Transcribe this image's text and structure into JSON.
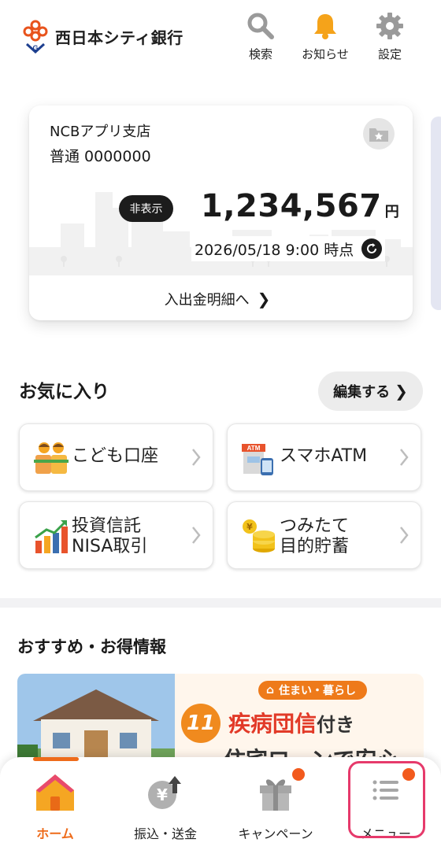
{
  "header": {
    "bank_name": "西日本シティ銀行",
    "search_label": "検索",
    "notify_label": "お知らせ",
    "settings_label": "設定"
  },
  "account_card": {
    "branch": "NCBアプリ支店",
    "account": "普通 0000000",
    "hide_label": "非表示",
    "balance": "1,234,567",
    "currency": "円",
    "as_of": "2026/05/18 9:00 時点",
    "detail_link": "入出金明細へ"
  },
  "favorites": {
    "title": "お気に入り",
    "edit_label": "編集する",
    "items": [
      {
        "line1": "こども口座",
        "line2": ""
      },
      {
        "line1": "スマホATM",
        "line2": ""
      },
      {
        "line1": "投資信託",
        "line2": "NISA取引"
      },
      {
        "line1": "つみたて",
        "line2": "目的貯蓄"
      }
    ]
  },
  "recommend": {
    "title": "おすすめ・お得情報",
    "banner": {
      "tag": "住まい・暮らし",
      "number": "11",
      "line1_highlight": "疾病団信",
      "line1_rest": "付き",
      "line2": "住宅ローンで安心"
    }
  },
  "bottom_nav": {
    "items": [
      {
        "label": "ホーム",
        "active": true
      },
      {
        "label": "振込・送金",
        "active": false
      },
      {
        "label": "キャンペーン",
        "active": false
      },
      {
        "label": "メニュー",
        "active": false
      }
    ]
  },
  "colors": {
    "accent": "#ee6b1a",
    "badge": "#f25a1d",
    "highlight_border": "#e63a6b"
  }
}
